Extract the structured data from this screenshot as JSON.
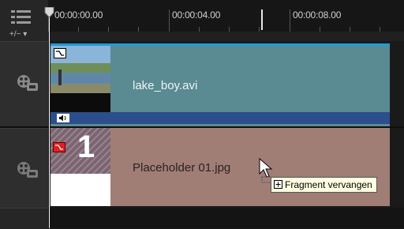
{
  "ruler": {
    "timecodes": [
      "00:00:00.00",
      "00:00:04.00",
      "00:00:08.00"
    ]
  },
  "header": {
    "zoom_label": "+/− ▾",
    "menu_icon": "list-icon"
  },
  "tracks": [
    {
      "type": "video",
      "icon": "film-reel-icon",
      "clip": {
        "name": "lake_boy.avi",
        "accent": "#1e9bd7",
        "color": "#5a8a92",
        "audio_icon": "speaker-icon"
      }
    },
    {
      "type": "overlay",
      "icon": "film-reel-icon",
      "clip": {
        "name": "Placeholder 01.jpg",
        "color": "#a07e76",
        "thumb_number": "1"
      }
    }
  ],
  "drag": {
    "tooltip": "Fragment vervangen",
    "cursor_icon": "arrow-cursor-icon",
    "plus_icon": "plus-box-icon"
  }
}
